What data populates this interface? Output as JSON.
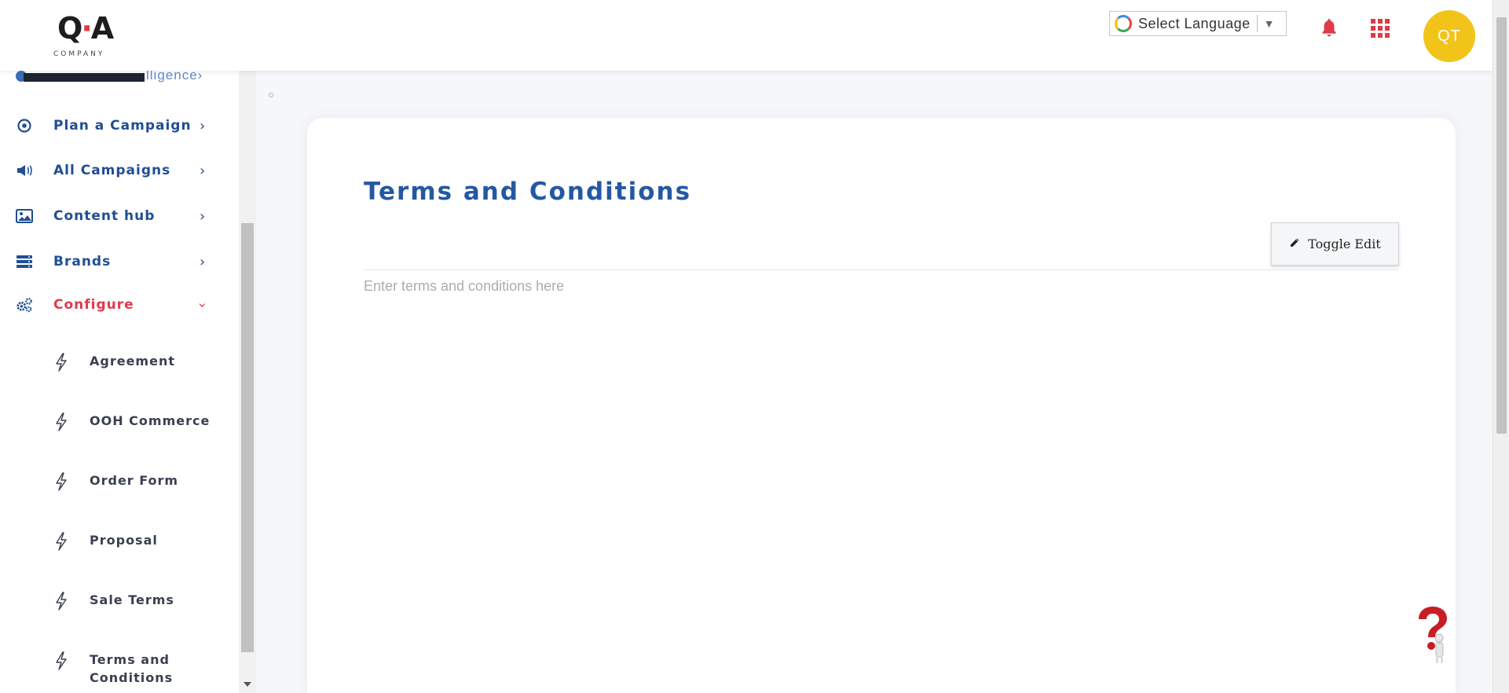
{
  "header": {
    "logo_text": "QA",
    "logo_subtext": "COMPANY",
    "language_label": "Select Language",
    "language_caret": "▼",
    "avatar_initials": "QT"
  },
  "sidebar": {
    "partial_item_text": "lligence",
    "items": [
      {
        "label": "Plan a Campaign",
        "icon": "target-icon"
      },
      {
        "label": "All Campaigns",
        "icon": "megaphone-icon"
      },
      {
        "label": "Content hub",
        "icon": "image-icon"
      },
      {
        "label": "Brands",
        "icon": "stack-icon"
      },
      {
        "label": "Configure",
        "icon": "gears-icon",
        "expanded": true
      }
    ],
    "sub_items": [
      {
        "label": "Agreement"
      },
      {
        "label": "OOH Commerce"
      },
      {
        "label": "Order Form"
      },
      {
        "label": "Proposal"
      },
      {
        "label": "Sale Terms"
      },
      {
        "label": "Terms and Conditions"
      }
    ]
  },
  "main": {
    "title": "Terms and Conditions",
    "toggle_button_label": "Toggle Edit",
    "editor_placeholder": "Enter terms and conditions here"
  },
  "colors": {
    "primary": "#2458a3",
    "accent": "#e03a4a",
    "avatar": "#f2c419"
  }
}
